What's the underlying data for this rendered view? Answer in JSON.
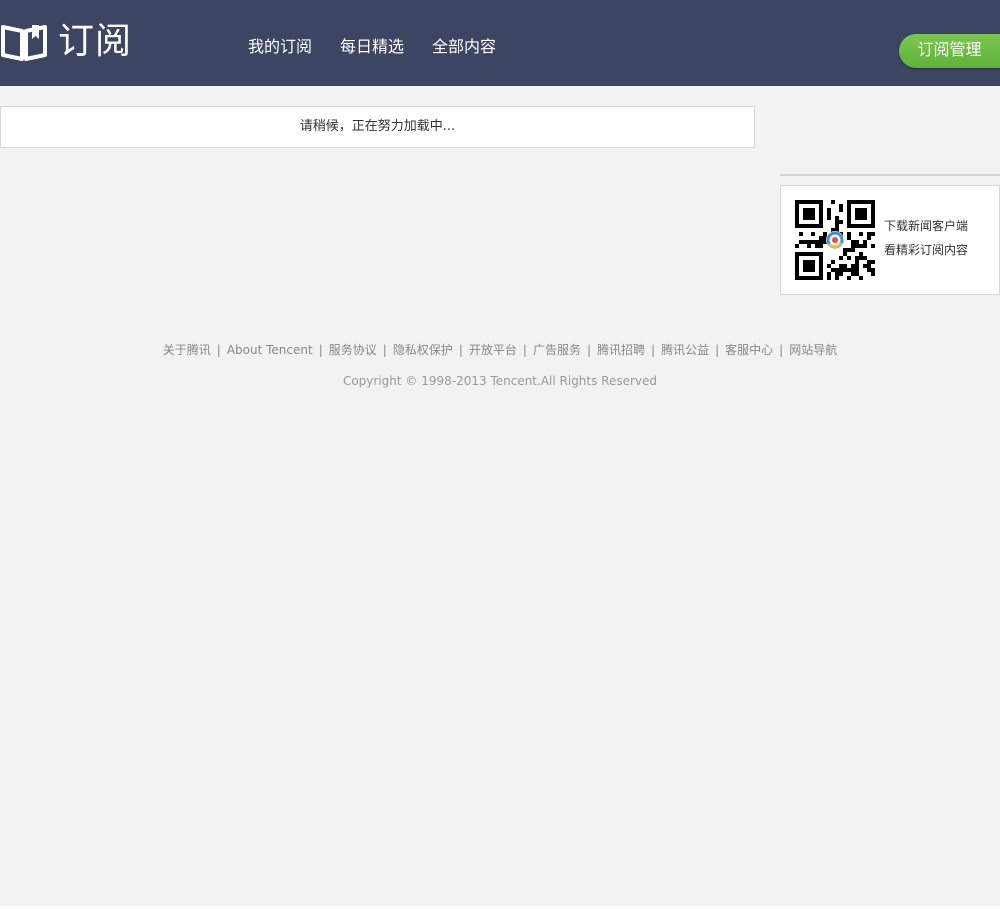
{
  "header": {
    "logo_text": "订阅",
    "nav": [
      "我的订阅",
      "每日精选",
      "全部内容"
    ],
    "manage_button": "订阅管理",
    "bg_color": "#3c4562",
    "accent_color": "#6bbd45"
  },
  "main": {
    "loading_text": "请稍候，正在努力加载中..."
  },
  "sidebar": {
    "qr_icon": "qr-code-icon",
    "qr_line1": "下载新闻客户端",
    "qr_line2": "看精彩订阅内容"
  },
  "footer": {
    "links": [
      "关于腾讯",
      "About Tencent",
      "服务协议",
      "隐私权保护",
      "开放平台",
      "广告服务",
      "腾讯招聘",
      "腾讯公益",
      "客服中心",
      "网站导航"
    ],
    "copyright": "Copyright © 1998-2013 Tencent.All Rights Reserved"
  }
}
